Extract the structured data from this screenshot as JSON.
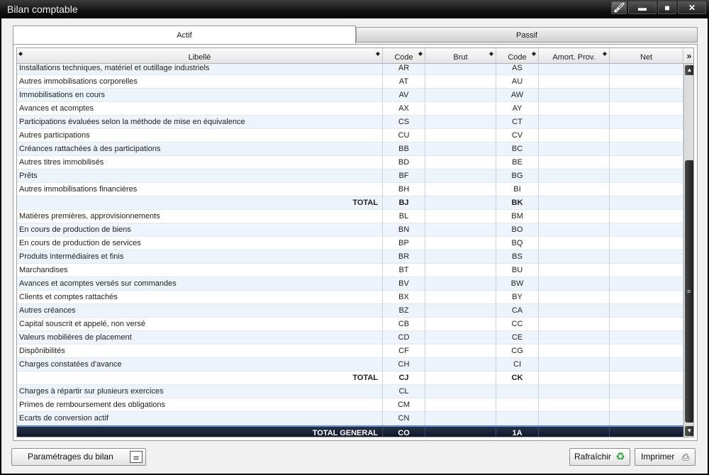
{
  "window": {
    "title": "Bilan comptable"
  },
  "titlebar_buttons": {
    "brush_icon": "brush-icon",
    "minimize": "▬",
    "maximize": "■",
    "close": "✕"
  },
  "tabs": [
    {
      "label": "Actif",
      "active": true
    },
    {
      "label": "Passif",
      "active": false
    }
  ],
  "columns": {
    "libelle": "Libellé",
    "code": "Code",
    "brut": "Brut",
    "code2": "Code",
    "amort": "Amort. Prov.",
    "net": "Net",
    "expand_icon": "»"
  },
  "rows": [
    {
      "libelle": "Installations techniques, matériel et outillage industriels",
      "code": "AR",
      "brut": "",
      "code2": "AS",
      "amort": "",
      "net": ""
    },
    {
      "libelle": "Autres immobilisations corporelles",
      "code": "AT",
      "brut": "",
      "code2": "AU",
      "amort": "",
      "net": ""
    },
    {
      "libelle": "Immobilisations en cours",
      "code": "AV",
      "brut": "",
      "code2": "AW",
      "amort": "",
      "net": ""
    },
    {
      "libelle": "Avances et acomptes",
      "code": "AX",
      "brut": "",
      "code2": "AY",
      "amort": "",
      "net": ""
    },
    {
      "libelle": "Participations évaluées selon la méthode de mise en équivalence",
      "code": "CS",
      "brut": "",
      "code2": "CT",
      "amort": "",
      "net": ""
    },
    {
      "libelle": "Autres participations",
      "code": "CU",
      "brut": "",
      "code2": "CV",
      "amort": "",
      "net": ""
    },
    {
      "libelle": "Créances rattachées à des participations",
      "code": "BB",
      "brut": "",
      "code2": "BC",
      "amort": "",
      "net": ""
    },
    {
      "libelle": "Autres titres immobilisés",
      "code": "BD",
      "brut": "",
      "code2": "BE",
      "amort": "",
      "net": ""
    },
    {
      "libelle": "Prêts",
      "code": "BF",
      "brut": "",
      "code2": "BG",
      "amort": "",
      "net": ""
    },
    {
      "libelle": "Autres immobilisations financières",
      "code": "BH",
      "brut": "",
      "code2": "BI",
      "amort": "",
      "net": ""
    },
    {
      "libelle": "TOTAL",
      "code": "BJ",
      "brut": "",
      "code2": "BK",
      "amort": "",
      "net": "",
      "kind": "total"
    },
    {
      "libelle": "Matières premières, approvisionnements",
      "code": "BL",
      "brut": "",
      "code2": "BM",
      "amort": "",
      "net": ""
    },
    {
      "libelle": "En cours de production de biens",
      "code": "BN",
      "brut": "",
      "code2": "BO",
      "amort": "",
      "net": ""
    },
    {
      "libelle": "En cours de production de services",
      "code": "BP",
      "brut": "",
      "code2": "BQ",
      "amort": "",
      "net": ""
    },
    {
      "libelle": "Produits intermédiaires et finis",
      "code": "BR",
      "brut": "",
      "code2": "BS",
      "amort": "",
      "net": ""
    },
    {
      "libelle": "Marchandises",
      "code": "BT",
      "brut": "",
      "code2": "BU",
      "amort": "",
      "net": ""
    },
    {
      "libelle": "Avances et acomptes versés sur commandes",
      "code": "BV",
      "brut": "",
      "code2": "BW",
      "amort": "",
      "net": ""
    },
    {
      "libelle": "Clients et comptes rattachés",
      "code": "BX",
      "brut": "",
      "code2": "BY",
      "amort": "",
      "net": ""
    },
    {
      "libelle": "Autres créances",
      "code": "BZ",
      "brut": "",
      "code2": "CA",
      "amort": "",
      "net": ""
    },
    {
      "libelle": "Capital souscrit et appelé, non versé",
      "code": "CB",
      "brut": "",
      "code2": "CC",
      "amort": "",
      "net": ""
    },
    {
      "libelle": "Valeurs mobilières de placement",
      "code": "CD",
      "brut": "",
      "code2": "CE",
      "amort": "",
      "net": ""
    },
    {
      "libelle": "Dispônibilités",
      "code": "CF",
      "brut": "",
      "code2": "CG",
      "amort": "",
      "net": ""
    },
    {
      "libelle": "Charges constatées d'avance",
      "code": "CH",
      "brut": "",
      "code2": "CI",
      "amort": "",
      "net": ""
    },
    {
      "libelle": "TOTAL",
      "code": "CJ",
      "brut": "",
      "code2": "CK",
      "amort": "",
      "net": "",
      "kind": "total"
    },
    {
      "libelle": "Charges à répartir sur plusieurs exercices",
      "code": "CL",
      "brut": "",
      "code2": "",
      "amort": "",
      "net": ""
    },
    {
      "libelle": "Primes de remboursement des obligations",
      "code": "CM",
      "brut": "",
      "code2": "",
      "amort": "",
      "net": ""
    },
    {
      "libelle": "Ecarts de conversion actif",
      "code": "CN",
      "brut": "",
      "code2": "",
      "amort": "",
      "net": ""
    },
    {
      "libelle": "TOTAL GENERAL",
      "code": "CO",
      "brut": "",
      "code2": "1A",
      "amort": "",
      "net": "",
      "kind": "general"
    }
  ],
  "buttons": {
    "parametrages": {
      "label": "Paramétrages du bilan",
      "icon": "settings-sliders-icon"
    },
    "rafraichir": {
      "label": "Rafraîchir",
      "icon": "recycle-icon"
    },
    "imprimer": {
      "label": "Imprimer",
      "icon": "printer-icon"
    }
  },
  "colors": {
    "accent_header": "#0c1426",
    "row_alt": "#eef4fb"
  }
}
